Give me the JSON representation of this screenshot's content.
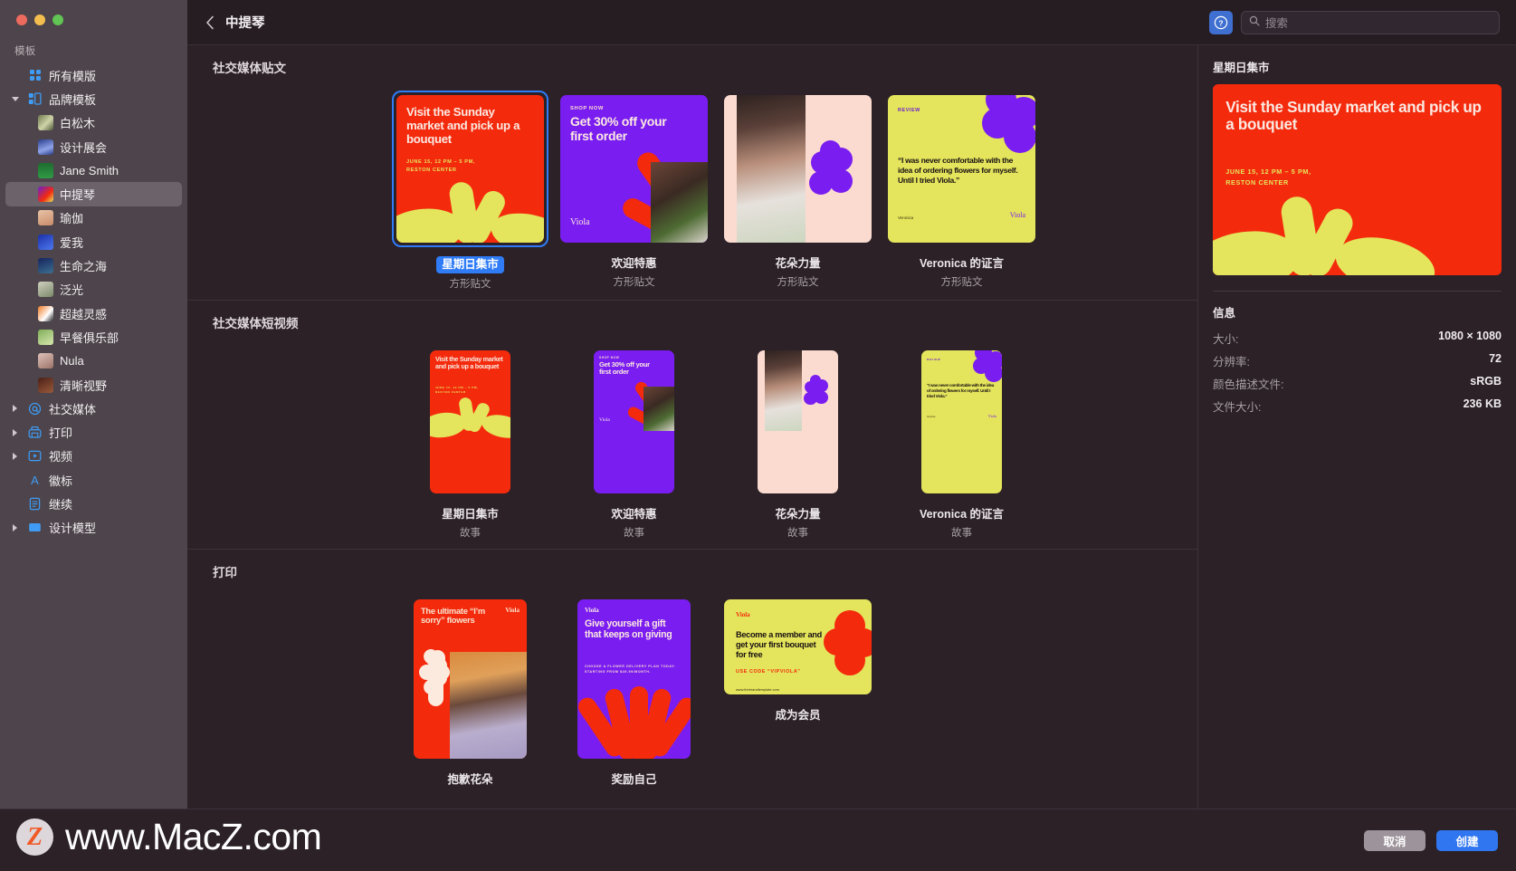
{
  "window": {
    "title": "中提琴",
    "back_icon": "chevron-left-icon",
    "help_icon": "help-circle-icon"
  },
  "search": {
    "placeholder": "搜索",
    "value": "",
    "icon": "search-icon"
  },
  "sidebar": {
    "header": "模板",
    "items": [
      {
        "label": "所有模版",
        "icon": "grid-icon",
        "level": 0,
        "twisty": "none",
        "selected": false
      },
      {
        "label": "品牌模板",
        "icon": "brand-icon",
        "level": 0,
        "twisty": "open",
        "selected": false
      },
      {
        "label": "白松木",
        "icon": "thumb-whitepine",
        "level": 1,
        "twisty": "none",
        "selected": false
      },
      {
        "label": "设计展会",
        "icon": "thumb-designfair",
        "level": 1,
        "twisty": "none",
        "selected": false
      },
      {
        "label": "Jane Smith",
        "icon": "thumb-janesmith",
        "level": 1,
        "twisty": "none",
        "selected": false
      },
      {
        "label": "中提琴",
        "icon": "thumb-viola",
        "level": 1,
        "twisty": "none",
        "selected": true
      },
      {
        "label": "瑜伽",
        "icon": "thumb-yoga",
        "level": 1,
        "twisty": "none",
        "selected": false
      },
      {
        "label": "爱我",
        "icon": "thumb-loveme",
        "level": 1,
        "twisty": "none",
        "selected": false
      },
      {
        "label": "生命之海",
        "icon": "thumb-seaoflife",
        "level": 1,
        "twisty": "none",
        "selected": false
      },
      {
        "label": "泛光",
        "icon": "thumb-bloom",
        "level": 1,
        "twisty": "none",
        "selected": false
      },
      {
        "label": "超越灵感",
        "icon": "thumb-beyond",
        "level": 1,
        "twisty": "none",
        "selected": false
      },
      {
        "label": "早餐俱乐部",
        "icon": "thumb-breakfast",
        "level": 1,
        "twisty": "none",
        "selected": false
      },
      {
        "label": "Nula",
        "icon": "thumb-nula",
        "level": 1,
        "twisty": "none",
        "selected": false
      },
      {
        "label": "清晰视野",
        "icon": "thumb-clearview",
        "level": 1,
        "twisty": "none",
        "selected": false
      },
      {
        "label": "社交媒体",
        "icon": "at-icon",
        "level": 0,
        "twisty": "closed",
        "selected": false
      },
      {
        "label": "打印",
        "icon": "printer-icon",
        "level": 0,
        "twisty": "closed",
        "selected": false
      },
      {
        "label": "视频",
        "icon": "video-icon",
        "level": 0,
        "twisty": "closed",
        "selected": false
      },
      {
        "label": "徽标",
        "icon": "letter-a-icon",
        "level": 0,
        "twisty": "none",
        "selected": false
      },
      {
        "label": "继续",
        "icon": "document-icon",
        "level": 0,
        "twisty": "none",
        "selected": false
      },
      {
        "label": "设计模型",
        "icon": "mockup-icon",
        "level": 0,
        "twisty": "closed",
        "selected": false
      }
    ]
  },
  "sections": [
    {
      "title": "社交媒体贴文",
      "kind": "square",
      "cards": [
        {
          "name": "星期日集市",
          "type": "方形贴文",
          "art": "sunday-red",
          "selected": true
        },
        {
          "name": "欢迎特惠",
          "type": "方形贴文",
          "art": "offer-purple",
          "selected": false
        },
        {
          "name": "花朵力量",
          "type": "方形贴文",
          "art": "flowerpower-pink",
          "selected": false
        },
        {
          "name": "Veronica 的证言",
          "type": "方形贴文",
          "art": "review-lime",
          "selected": false
        }
      ]
    },
    {
      "title": "社交媒体短视频",
      "kind": "story",
      "cards": [
        {
          "name": "星期日集市",
          "type": "故事",
          "art": "sunday-red",
          "selected": false
        },
        {
          "name": "欢迎特惠",
          "type": "故事",
          "art": "offer-purple",
          "selected": false
        },
        {
          "name": "花朵力量",
          "type": "故事",
          "art": "flowerpower-pink",
          "selected": false
        },
        {
          "name": "Veronica 的证言",
          "type": "故事",
          "art": "review-lime",
          "selected": false
        }
      ]
    },
    {
      "title": "打印",
      "kind": "print",
      "cards": [
        {
          "name": "抱歉花朵",
          "type": "",
          "art": "sorry-red",
          "selected": false
        },
        {
          "name": "奖励自己",
          "type": "",
          "art": "gift-purple",
          "selected": false
        },
        {
          "name": "成为会员",
          "type": "",
          "art": "member-lime",
          "selected": false
        }
      ]
    }
  ],
  "artwork": {
    "sunday": {
      "headline": "Visit the Sunday market and pick up a bouquet",
      "detail_line1": "JUNE 15, 12 PM – 5 PM,",
      "detail_line2": "RESTON CENTER"
    },
    "offer": {
      "kicker": "SHOP NOW",
      "headline": "Get 30% off your first order",
      "brand": "Viola"
    },
    "flowerpower": {
      "brand": ""
    },
    "review": {
      "kicker": "REVIEW",
      "quote": "“I was never comfortable with the idea of ordering flowers for myself. Until I tried Viola.”",
      "attribution": "Veronica",
      "brand": "Viola"
    },
    "sorry": {
      "headline": "The ultimate “I’m sorry” flowers",
      "brand": "Viola"
    },
    "gift": {
      "brand": "Viola",
      "headline": "Give yourself a gift that keeps on giving",
      "detail_line1": "CHOOSE A FLOWER DELIVERY PLAN TODAY.",
      "detail_line2": "STARTING FROM $49.99/MONTH."
    },
    "member": {
      "brand": "Viola",
      "headline": "Become a member and get your first bouquet for free",
      "code": "USE CODE “VIPVIOLA”",
      "url": "www.thebrandtemplate.com"
    }
  },
  "inspector": {
    "title": "星期日集市",
    "info_heading": "信息",
    "rows": [
      {
        "key": "大小:",
        "value": "1080 × 1080"
      },
      {
        "key": "分辨率:",
        "value": "72"
      },
      {
        "key": "颜色描述文件:",
        "value": "sRGB"
      },
      {
        "key": "文件大小:",
        "value": "236 KB"
      }
    ]
  },
  "footer": {
    "cancel_label": "取消",
    "create_label": "创建"
  },
  "watermark": {
    "mark": "Z",
    "text": "www.MacZ.com"
  },
  "colors": {
    "accent": "#3076f6",
    "red": "#f42a0d",
    "purple": "#7a1df0",
    "lime": "#e4e55c",
    "pink": "#fbdbd0",
    "sidebar_bg": "#4d454b",
    "app_bg": "#2b2127"
  }
}
